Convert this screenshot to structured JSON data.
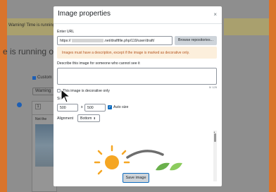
{
  "background": {
    "warning_text": "Warning! Time is running",
    "heading": "e is running ou",
    "custom_label": "Custom",
    "warning_button": "Warning",
    "editor_button": "1",
    "editor_note": "Not the"
  },
  "modal": {
    "title": "Image properties",
    "close": "×",
    "enter_url_label": "Enter URL",
    "url_prefix": "https://",
    "url_suffix": ".net/draftfile.php/119/user/draft/",
    "browse_button": "Browse repositories...",
    "alert_text": "Images must have a description, except if the image is marked as decorative only.",
    "describe_label": "Describe this image for someone who cannot see it",
    "char_count": "0/ 125",
    "decorative_label": "This image is decorative only",
    "size_label": "Si",
    "width_value": "500",
    "size_separator": "x",
    "height_value": "500",
    "auto_size_label": "Auto size",
    "alignment_label": "Alignment",
    "alignment_value": "Bottom",
    "save_button": "Save image"
  },
  "colors": {
    "accent": "#0f6cbf",
    "alert_bg": "#fcefdc",
    "alert_text": "#b4561f",
    "sun": "#f5a623"
  }
}
